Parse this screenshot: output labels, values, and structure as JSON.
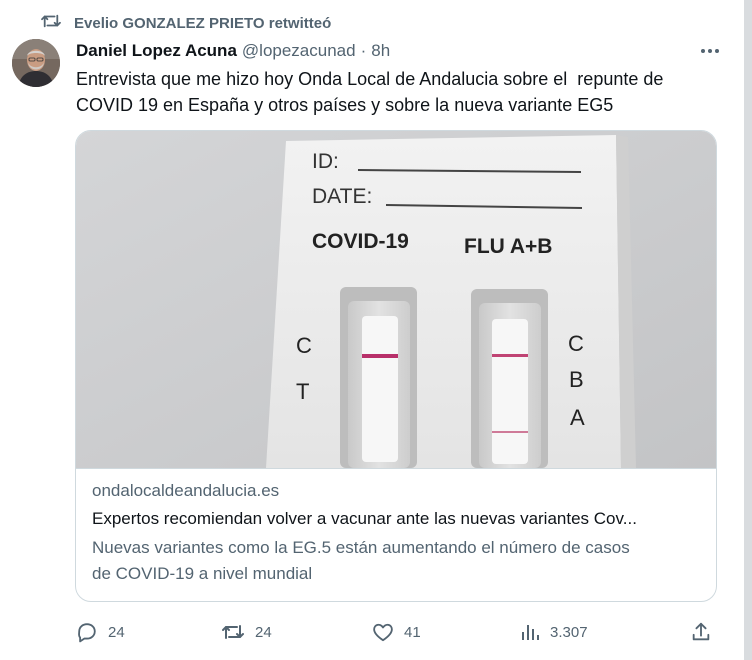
{
  "retweet": {
    "text": "Evelio GONZALEZ PRIETO retwitteó",
    "icon": "retweet-icon"
  },
  "author": {
    "name": "Daniel Lopez Acuna",
    "handle": "@lopezacunad",
    "separator": "·",
    "time": "8h"
  },
  "tweet": {
    "lines": [
      "Entrevista que me hizo hoy Onda Local de Andalucia sobre el  repunte de",
      "COVID 19 en España y otros países y sobre la nueva variante EG5"
    ]
  },
  "card": {
    "image": {
      "id_label": "ID:",
      "date_label": "DATE:",
      "left_label": "COVID-19",
      "right_label": "FLU A+B",
      "marks_left": [
        "C",
        "T"
      ],
      "marks_right": [
        "C",
        "B",
        "A"
      ]
    },
    "domain": "ondalocaldeandalucia.es",
    "title": "Expertos recomiendan volver a vacunar ante las nuevas variantes Cov...",
    "description_lines": [
      "Nuevas variantes como la EG.5 están aumentando el número de casos",
      "de COVID-19 a nivel mundial"
    ]
  },
  "actions": {
    "replies": "24",
    "retweets": "24",
    "likes": "41",
    "views": "3.307",
    "icons": [
      "reply-icon",
      "retweet-icon",
      "like-icon",
      "views-icon",
      "share-icon"
    ]
  },
  "colors": {
    "text": "#0f1419",
    "secondary": "#536471",
    "border": "#cfd9de",
    "test_line": "#b8306a"
  }
}
